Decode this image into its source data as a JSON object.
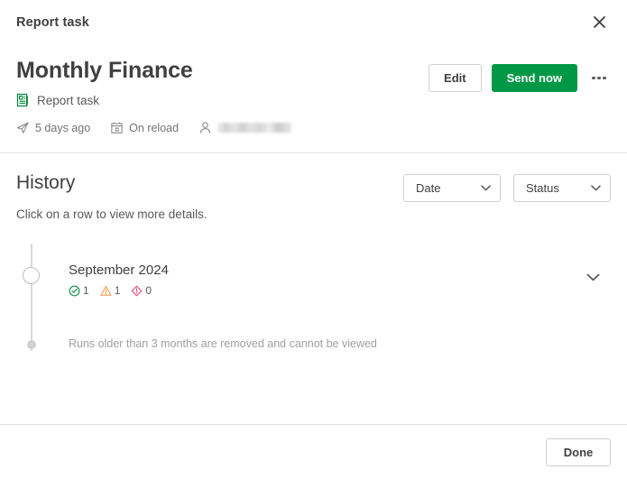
{
  "window": {
    "title": "Report task",
    "close_icon": "close-icon"
  },
  "header": {
    "doc_title": "Monthly Finance",
    "type_icon": "report-task-icon",
    "type_label": "Report task",
    "meta": [
      {
        "icon": "send-paper-plane-icon",
        "text": "5 days ago"
      },
      {
        "icon": "calendar-icon",
        "text": "On reload"
      },
      {
        "icon": "user-icon",
        "text": "",
        "redacted": true
      }
    ],
    "actions": {
      "edit_label": "Edit",
      "send_now_label": "Send now",
      "more_icon": "kebab-menu-icon"
    }
  },
  "history": {
    "title": "History",
    "hint": "Click on a row to view more details.",
    "filters": [
      {
        "name": "date",
        "label": "Date"
      },
      {
        "name": "status",
        "label": "Status"
      }
    ],
    "runs": [
      {
        "date": "September 2024",
        "statuses": [
          {
            "icon": "success-check-circle-icon",
            "count": "1",
            "color": "#00873C"
          },
          {
            "icon": "warning-triangle-icon",
            "count": "1",
            "color": "#F2994A"
          },
          {
            "icon": "error-diamond-icon",
            "count": "0",
            "color": "#E5426B"
          }
        ],
        "expand_icon": "chevron-down-icon"
      }
    ],
    "retention_note": "Runs older than 3 months are removed and cannot be viewed"
  },
  "footer": {
    "done_label": "Done"
  },
  "colors": {
    "accent_green": "#009845",
    "success": "#00873C",
    "warning": "#F2994A",
    "error": "#E5426B",
    "text": "#404040",
    "muted": "#737373",
    "border": "#e0e0e0"
  }
}
